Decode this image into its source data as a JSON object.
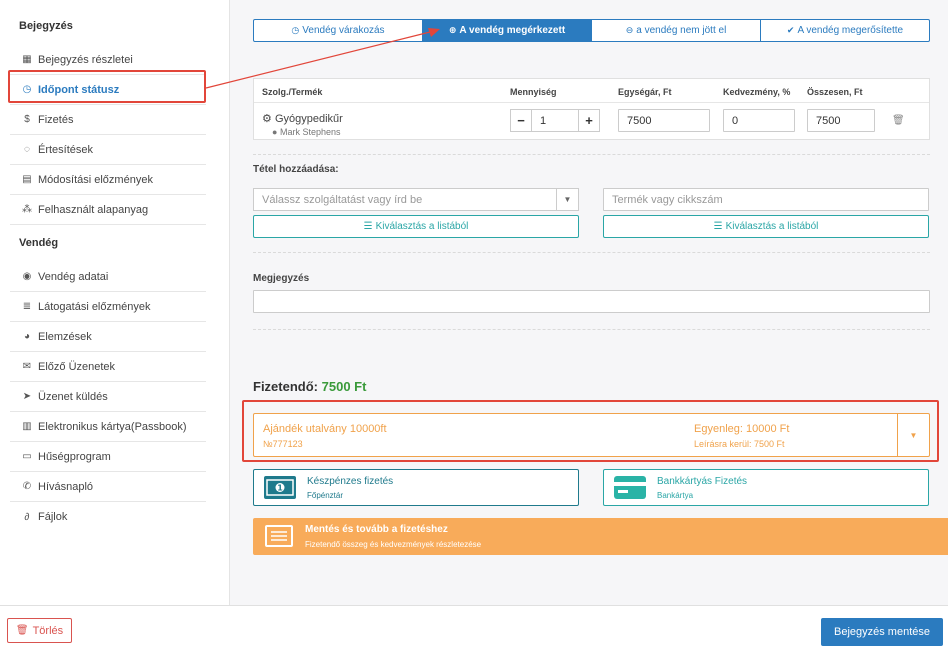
{
  "sidebar": {
    "section1": "Bejegyzés",
    "items1": [
      {
        "label": "Bejegyzés részletei",
        "icon": "calendar-icon",
        "glyph": "▦"
      },
      {
        "label": "Időpont státusz",
        "icon": "clock-icon",
        "glyph": "◷",
        "active": true
      },
      {
        "label": "Fizetés",
        "icon": "dollar-icon",
        "glyph": "$"
      },
      {
        "label": "Értesítések",
        "icon": "comment-icon",
        "glyph": "◌"
      },
      {
        "label": "Módosítási előzmények",
        "icon": "file-icon",
        "glyph": "▤"
      },
      {
        "label": "Felhasznált alapanyag",
        "icon": "cubes-icon",
        "glyph": "⁂"
      }
    ],
    "section2": "Vendég",
    "items2": [
      {
        "label": "Vendég adatai",
        "icon": "user-icon",
        "glyph": "◉"
      },
      {
        "label": "Látogatási előzmények",
        "icon": "list-icon",
        "glyph": "≣"
      },
      {
        "label": "Elemzések",
        "icon": "pie-chart-icon",
        "glyph": "◕"
      },
      {
        "label": "Előző Üzenetek",
        "icon": "envelope-icon",
        "glyph": "✉"
      },
      {
        "label": "Üzenet küldés",
        "icon": "paper-plane-icon",
        "glyph": "➤"
      },
      {
        "label": "Elektronikus kártya(Passbook)",
        "icon": "id-card-icon",
        "glyph": "▥"
      },
      {
        "label": "Hűségprogram",
        "icon": "credit-card-icon",
        "glyph": "▭"
      },
      {
        "label": "Hívásnapló",
        "icon": "phone-icon",
        "glyph": "✆"
      },
      {
        "label": "Fájlok",
        "icon": "paperclip-icon",
        "glyph": "∂"
      }
    ]
  },
  "status_tabs": [
    {
      "label": "Vendég várakozás",
      "glyph": "◷"
    },
    {
      "label": "A vendég megérkezett",
      "glyph": "⊕",
      "active": true
    },
    {
      "label": "a vendég nem jött el",
      "glyph": "⊖"
    },
    {
      "label": "A vendég megerősítette",
      "glyph": "✔"
    }
  ],
  "table": {
    "headers": {
      "product": "Szolg./Termék",
      "qty": "Mennyiség",
      "unit_price": "Egységár, Ft",
      "discount": "Kedvezmény, %",
      "total": "Összesen, Ft"
    },
    "row": {
      "name": "Gyógypedikűr",
      "staff": "Mark Stephens",
      "qty": "1",
      "unit_price": "7500",
      "discount": "0",
      "total": "7500"
    }
  },
  "add_item": {
    "label": "Tétel hozzáadása:",
    "service_placeholder": "Válassz szolgáltatást vagy írd be",
    "product_placeholder": "Termék vagy cikkszám",
    "list_btn": "Kiválasztás a listából"
  },
  "note": {
    "label": "Megjegyzés",
    "value": ""
  },
  "payment": {
    "label": "Fizetendő:",
    "amount": "7500 Ft",
    "voucher": {
      "title": "Ajándék utalvány 10000ft",
      "code": "№777123",
      "balance": "Egyenleg: 10000 Ft",
      "deduct": "Leírásra kerül: 7500 Ft"
    },
    "cash": {
      "title": "Készpénzes fizetés",
      "sub": "Főpénztár"
    },
    "card": {
      "title": "Bankkártyás Fizetés",
      "sub": "Bankártya"
    },
    "save_next": {
      "title": "Mentés és tovább a fizetéshez",
      "sub": "Fizetendő összeg és kedvezmények részletezése"
    }
  },
  "footer": {
    "delete": "Törlés",
    "save": "Bejegyzés mentése"
  },
  "colors": {
    "primary": "#2b7bbf",
    "teal": "#2aa6a6",
    "orange": "#f0a24b",
    "green": "#3a9a3a",
    "danger": "#d9534f",
    "highlight": "#e2463a"
  }
}
